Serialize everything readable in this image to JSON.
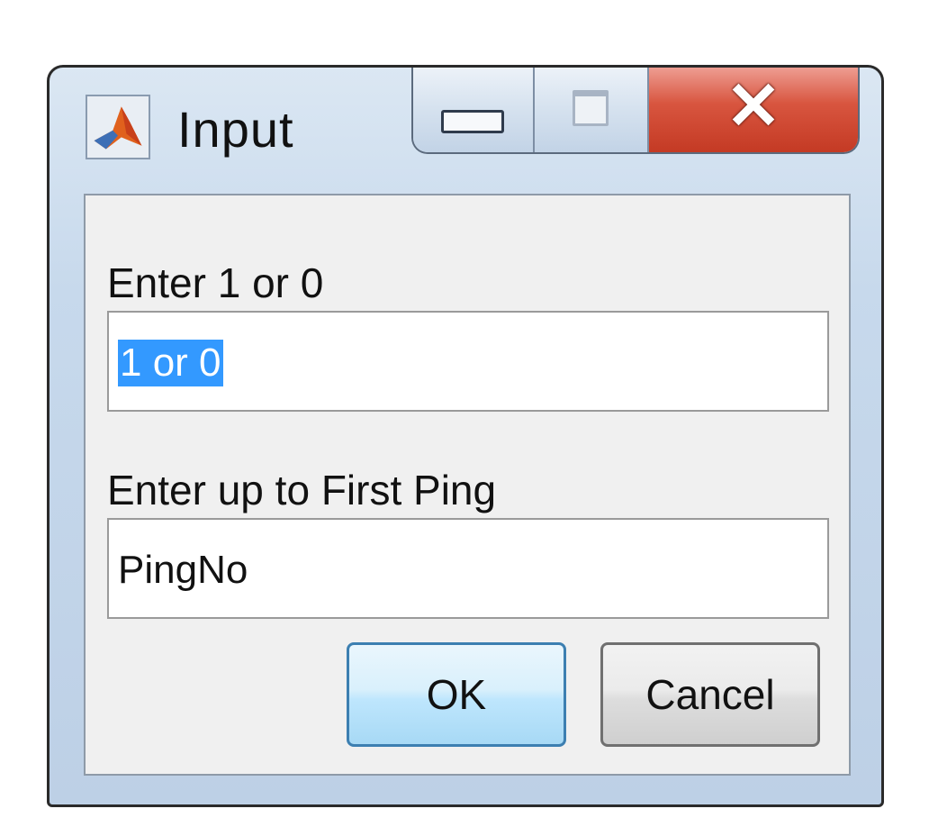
{
  "window": {
    "title": "Input",
    "icon": "matlab-icon",
    "controls": {
      "minimize": "minimize-icon",
      "maximize": "maximize-icon",
      "close": "close-icon"
    },
    "close_glyph": "✕"
  },
  "prompts": [
    {
      "label": "Enter 1 or 0",
      "value": "1 or 0",
      "selected": true
    },
    {
      "label": "Enter up to First Ping",
      "value": "PingNo",
      "selected": false
    }
  ],
  "buttons": {
    "ok_label": "OK",
    "cancel_label": "Cancel"
  },
  "colors": {
    "selection": "#3399ff",
    "close_button": "#c43a24",
    "ok_button_border": "#3c7fb1"
  }
}
